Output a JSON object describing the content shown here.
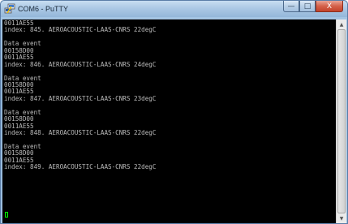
{
  "window": {
    "title": "COM6 - PuTTY",
    "app_icon": "putty-computer-icon"
  },
  "caption_buttons": {
    "minimize_icon": "minimize-icon",
    "maximize_icon": "maximize-icon",
    "close_icon": "close-icon",
    "minimize_glyph": "—",
    "maximize_glyph": "□",
    "close_glyph": "X"
  },
  "terminal": {
    "lines": [
      "0011AE55",
      "index: 845. AEROACOUSTIC-LAAS-CNRS 22degC",
      "",
      "Data event",
      "00158D00",
      "0011AE55",
      "index: 846. AEROACOUSTIC-LAAS-CNRS 24degC",
      "",
      "Data event",
      "00158D00",
      "0011AE55",
      "index: 847. AEROACOUSTIC-LAAS-CNRS 23degC",
      "",
      "Data event",
      "00158D00",
      "0011AE55",
      "index: 848. AEROACOUSTIC-LAAS-CNRS 22degC",
      "",
      "Data event",
      "00158D00",
      "0011AE55",
      "index: 849. AEROACOUSTIC-LAAS-CNRS 22degC"
    ],
    "text_color": "#bbbbbb",
    "background": "#000000",
    "cursor_color": "#00ff00"
  },
  "scrollbar": {
    "up_glyph": "▲",
    "down_glyph": "▼"
  }
}
